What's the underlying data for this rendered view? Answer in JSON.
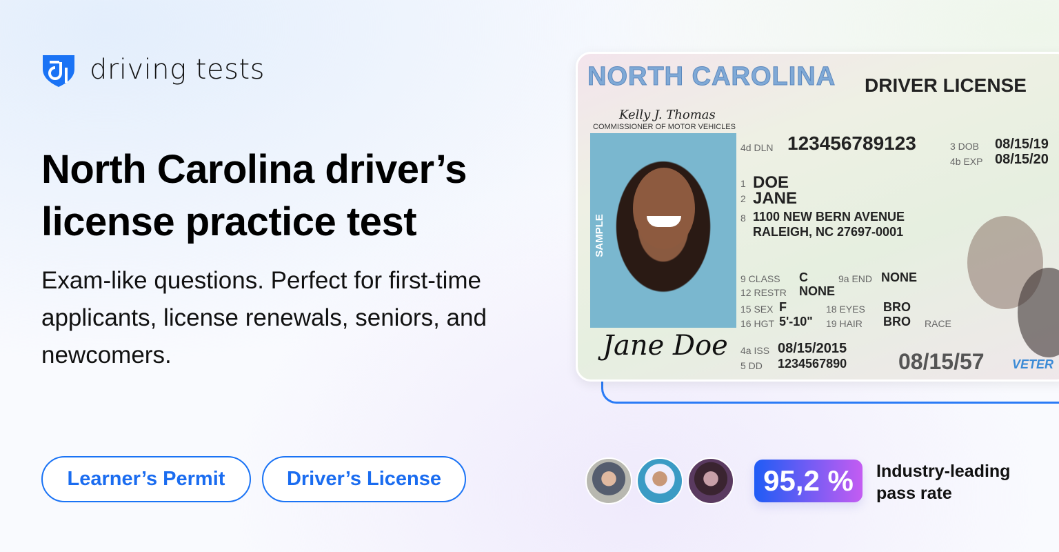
{
  "brand": {
    "name": "driving tests",
    "color": "#1a73f5"
  },
  "headline": "North Carolina driver’s license practice test",
  "subheadline": "Exam-like questions. Perfect for first-time applicants, license renewals, seniors, and newcomers.",
  "buttons": [
    {
      "label": "Learner’s Permit"
    },
    {
      "label": "Driver’s License"
    }
  ],
  "license": {
    "state": "NORTH CAROLINA",
    "type": "DRIVER LICENSE",
    "commissioner": "COMMISSIONER OF MOTOR VEHICLES",
    "commissioner_signature": "Kelly J. Thomas",
    "sample": "SAMPLE",
    "dln_label": "4d DLN",
    "dln": "123456789123",
    "dob_label": "3 DOB",
    "dob": "08/15/19",
    "exp_label": "4b EXP",
    "exp": "08/15/20",
    "last_name_label": "1",
    "last_name": "DOE",
    "first_name_label": "2",
    "first_name": "JANE",
    "address_label": "8",
    "address1": "1100 NEW BERN AVENUE",
    "address2": "RALEIGH, NC 27697-0001",
    "class_label": "9 CLASS",
    "class": "C",
    "end_label": "9a END",
    "end": "NONE",
    "restr_label": "12 RESTR",
    "restr": "NONE",
    "sex_label": "15 SEX",
    "sex": "F",
    "eyes_label": "18 EYES",
    "eyes": "BRO",
    "hgt_label": "16 HGT",
    "hgt": "5'-10\"",
    "hair_label": "19 HAIR",
    "hair": "BRO",
    "race_label": "RACE",
    "signature": "Jane Doe",
    "iss_label": "4a ISS",
    "iss": "08/15/2015",
    "dd_label": "5 DD",
    "dd": "1234567890",
    "dob_short": "08/15/57",
    "veteran": "VETER"
  },
  "stats": {
    "pass_rate": "95,2 %",
    "pass_rate_label": "Industry-leading pass rate"
  }
}
